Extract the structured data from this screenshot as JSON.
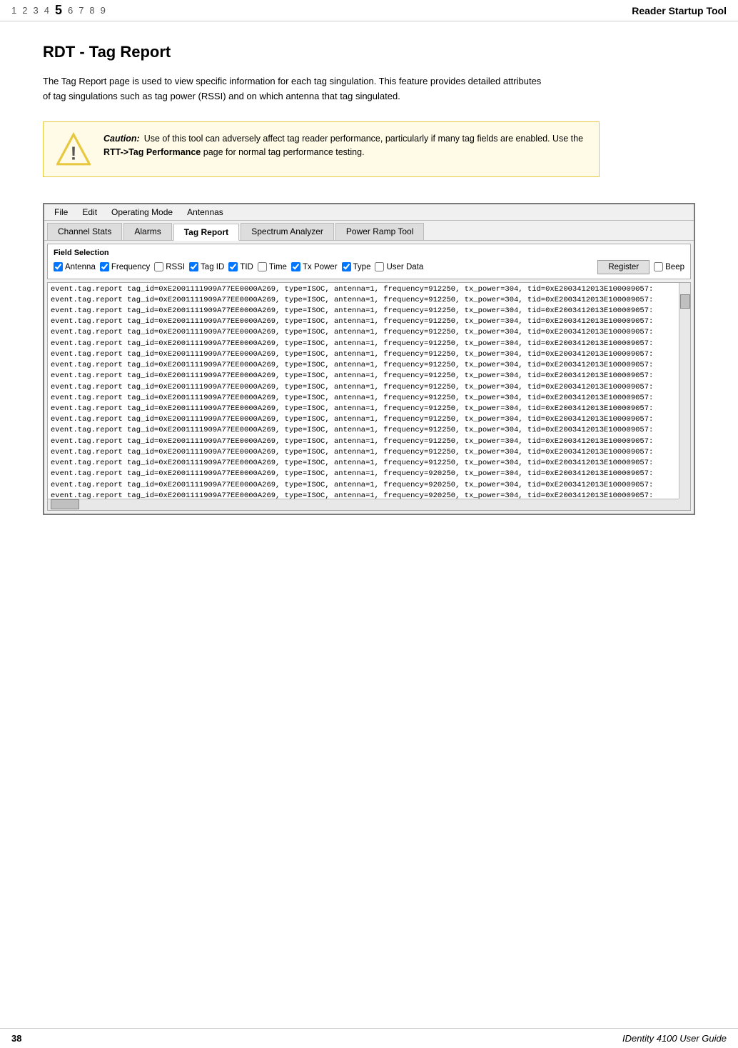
{
  "header": {
    "page_numbers": [
      "1",
      "2",
      "3",
      "4",
      "5",
      "6",
      "7",
      "8",
      "9"
    ],
    "active_page": "5",
    "title": "Reader Startup Tool"
  },
  "page": {
    "title": "RDT - Tag Report",
    "description": "The Tag Report page is used to view specific information for each tag singulation. This feature provides detailed attributes of tag singulations such as tag power (RSSI) and on which antenna that tag singulated."
  },
  "caution": {
    "label": "Caution:",
    "text_part1": "Use of this tool can adversely affect tag reader performance, particularly if many tag fields are enabled. Use the ",
    "link_text": "RTT->Tag Performance",
    "text_part2": " page for normal tag performance testing."
  },
  "app_window": {
    "menu_items": [
      "File",
      "Edit",
      "Operating Mode",
      "Antennas"
    ],
    "tabs": [
      {
        "label": "Channel Stats",
        "active": false
      },
      {
        "label": "Alarms",
        "active": false
      },
      {
        "label": "Tag Report",
        "active": true
      },
      {
        "label": "Spectrum Analyzer",
        "active": false
      },
      {
        "label": "Power Ramp Tool",
        "active": false
      }
    ],
    "field_selection": {
      "title": "Field Selection",
      "fields": [
        {
          "label": "Antenna",
          "checked": true
        },
        {
          "label": "Frequency",
          "checked": true
        },
        {
          "label": "RSSI",
          "checked": false
        },
        {
          "label": "Tag ID",
          "checked": true
        },
        {
          "label": "TID",
          "checked": true
        },
        {
          "label": "Time",
          "checked": false
        },
        {
          "label": "Tx Power",
          "checked": true
        },
        {
          "label": "Type",
          "checked": true
        },
        {
          "label": "User Data",
          "checked": false
        }
      ],
      "register_btn": "Register",
      "beep_label": "Beep",
      "beep_checked": false
    },
    "data_lines": [
      "event.tag.report tag_id=0xE2001111909A77EE0000A269, type=ISOC, antenna=1, frequency=912250, tx_power=304, tid=0xE2003412013E100009057:",
      "event.tag.report tag_id=0xE2001111909A77EE0000A269, type=ISOC, antenna=1, frequency=912250, tx_power=304, tid=0xE2003412013E100009057:",
      "event.tag.report tag_id=0xE2001111909A77EE0000A269, type=ISOC, antenna=1, frequency=912250, tx_power=304, tid=0xE2003412013E100009057:",
      "event.tag.report tag_id=0xE2001111909A77EE0000A269, type=ISOC, antenna=1, frequency=912250, tx_power=304, tid=0xE2003412013E100009057:",
      "event.tag.report tag_id=0xE2001111909A77EE0000A269, type=ISOC, antenna=1, frequency=912250, tx_power=304, tid=0xE2003412013E100009057:",
      "event.tag.report tag_id=0xE2001111909A77EE0000A269, type=ISOC, antenna=1, frequency=912250, tx_power=304, tid=0xE2003412013E100009057:",
      "event.tag.report tag_id=0xE2001111909A77EE0000A269, type=ISOC, antenna=1, frequency=912250, tx_power=304, tid=0xE2003412013E100009057:",
      "event.tag.report tag_id=0xE2001111909A77EE0000A269, type=ISOC, antenna=1, frequency=912250, tx_power=304, tid=0xE2003412013E100009057:",
      "event.tag.report tag_id=0xE2001111909A77EE0000A269, type=ISOC, antenna=1, frequency=912250, tx_power=304, tid=0xE2003412013E100009057:",
      "event.tag.report tag_id=0xE2001111909A77EE0000A269, type=ISOC, antenna=1, frequency=912250, tx_power=304, tid=0xE2003412013E100009057:",
      "event.tag.report tag_id=0xE2001111909A77EE0000A269, type=ISOC, antenna=1, frequency=912250, tx_power=304, tid=0xE2003412013E100009057:",
      "event.tag.report tag_id=0xE2001111909A77EE0000A269, type=ISOC, antenna=1, frequency=912250, tx_power=304, tid=0xE2003412013E100009057:",
      "event.tag.report tag_id=0xE2001111909A77EE0000A269, type=ISOC, antenna=1, frequency=912250, tx_power=304, tid=0xE2003412013E100009057:",
      "event.tag.report tag_id=0xE2001111909A77EE0000A269, type=ISOC, antenna=1, frequency=912250, tx_power=304, tid=0xE2003412013E100009057:",
      "event.tag.report tag_id=0xE2001111909A77EE0000A269, type=ISOC, antenna=1, frequency=912250, tx_power=304, tid=0xE2003412013E100009057:",
      "event.tag.report tag_id=0xE2001111909A77EE0000A269, type=ISOC, antenna=1, frequency=912250, tx_power=304, tid=0xE2003412013E100009057:",
      "event.tag.report tag_id=0xE2001111909A77EE0000A269, type=ISOC, antenna=1, frequency=912250, tx_power=304, tid=0xE2003412013E100009057:",
      "event.tag.report tag_id=0xE2001111909A77EE0000A269, type=ISOC, antenna=1, frequency=920250, tx_power=304, tid=0xE2003412013E100009057:",
      "event.tag.report tag_id=0xE2001111909A77EE0000A269, type=ISOC, antenna=1, frequency=920250, tx_power=304, tid=0xE2003412013E100009057:",
      "event.tag.report tag_id=0xE2001111909A77EE0000A269, type=ISOC, antenna=1, frequency=920250, tx_power=304, tid=0xE2003412013E100009057:"
    ]
  },
  "footer": {
    "page_number": "38",
    "title": "IDentity 4100 User Guide"
  }
}
